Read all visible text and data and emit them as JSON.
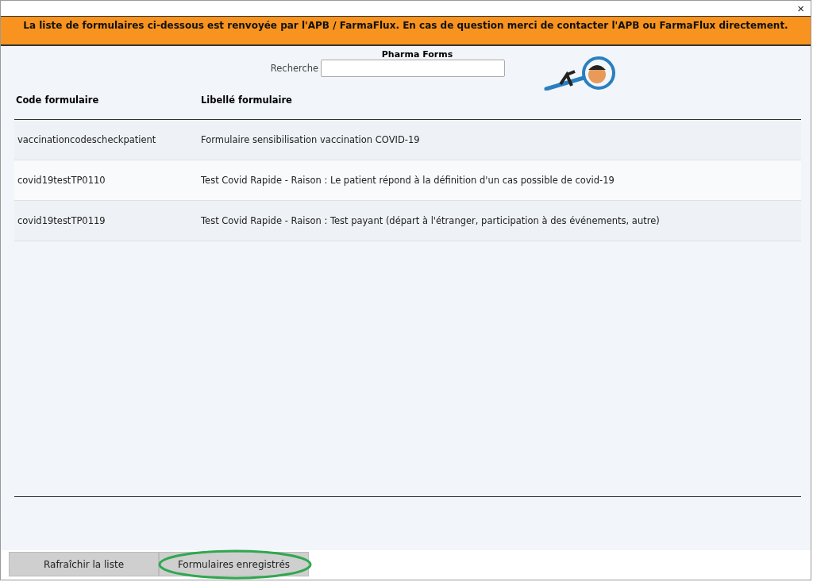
{
  "window": {
    "close": "×"
  },
  "banner": "La liste de formulaires ci-dessous est renvoyée par l'APB / FarmaFlux. En cas de question merci de contacter l'APB ou FarmaFlux directement.",
  "title": "Pharma Forms",
  "search": {
    "label": "Recherche"
  },
  "table": {
    "columns": [
      "Code formulaire",
      "Libellé formulaire"
    ],
    "rows": [
      {
        "code": "vaccinationcodescheckpatient",
        "label": "Formulaire sensibilisation vaccination COVID-19"
      },
      {
        "code": "covid19testTP0110",
        "label": "Test Covid Rapide - Raison : Le patient répond à la définition d'un cas possible de covid-19"
      },
      {
        "code": "covid19testTP0119",
        "label": "Test Covid Rapide - Raison : Test payant (départ à l'étranger, participation à des événements, autre)"
      }
    ]
  },
  "buttons": [
    {
      "label": "Rafraîchir la liste",
      "highlighted": false
    },
    {
      "label": "Formulaires enregistrés",
      "highlighted": true
    }
  ]
}
